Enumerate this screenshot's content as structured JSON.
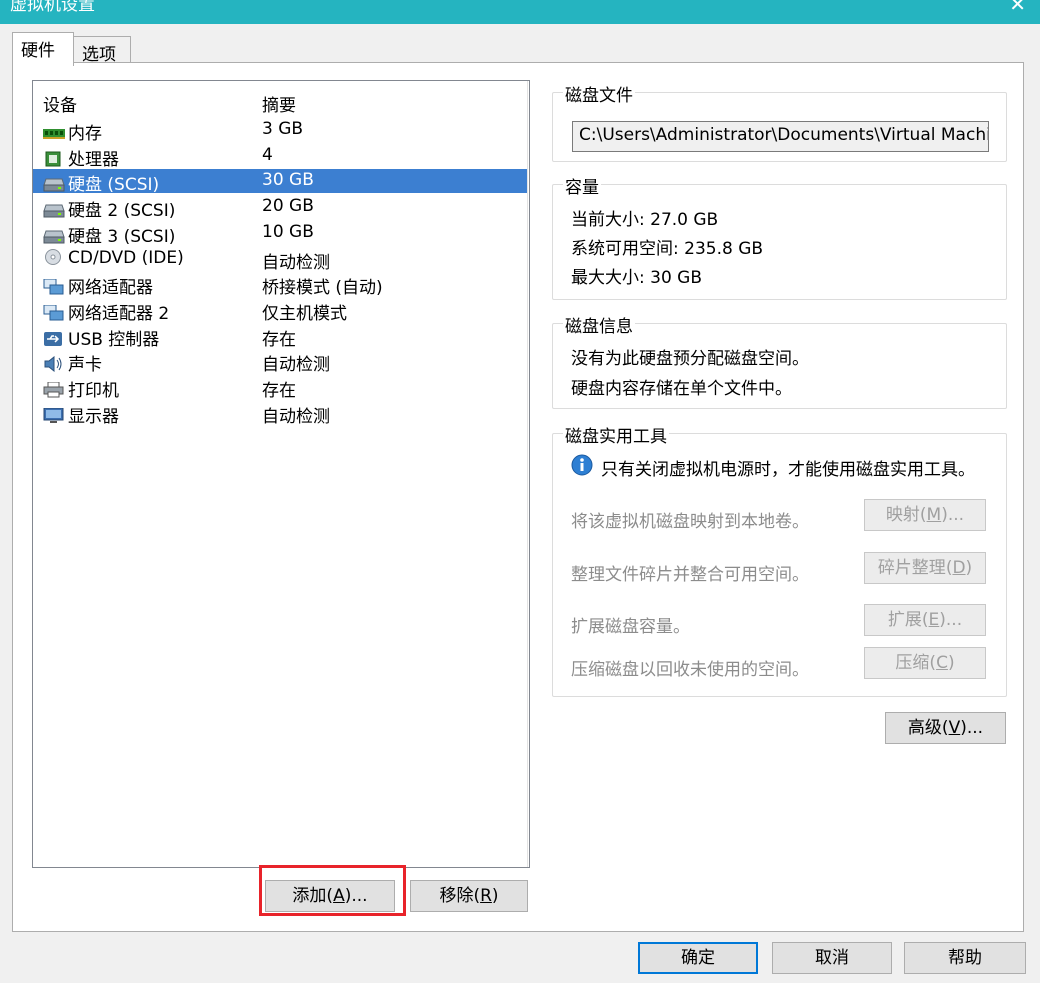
{
  "window": {
    "title": "虚拟机设置",
    "close_glyph": "✕"
  },
  "tabs": [
    {
      "label": "硬件"
    },
    {
      "label": "选项"
    }
  ],
  "device_list": {
    "columns": {
      "device": "设备",
      "summary": "摘要"
    },
    "items": [
      {
        "name": "内存",
        "summary": "3 GB",
        "icon": "memory-icon"
      },
      {
        "name": "处理器",
        "summary": "4",
        "icon": "processor-icon"
      },
      {
        "name": "硬盘 (SCSI)",
        "summary": "30 GB",
        "icon": "harddisk-icon"
      },
      {
        "name": "硬盘 2 (SCSI)",
        "summary": "20 GB",
        "icon": "harddisk-icon"
      },
      {
        "name": "硬盘 3 (SCSI)",
        "summary": "10 GB",
        "icon": "harddisk-icon"
      },
      {
        "name": "CD/DVD (IDE)",
        "summary": "自动检测",
        "icon": "cd-icon"
      },
      {
        "name": "网络适配器",
        "summary": "桥接模式 (自动)",
        "icon": "network-icon"
      },
      {
        "name": "网络适配器 2",
        "summary": "仅主机模式",
        "icon": "network-icon"
      },
      {
        "name": "USB 控制器",
        "summary": "存在",
        "icon": "usb-icon"
      },
      {
        "name": "声卡",
        "summary": "自动检测",
        "icon": "sound-icon"
      },
      {
        "name": "打印机",
        "summary": "存在",
        "icon": "printer-icon"
      },
      {
        "name": "显示器",
        "summary": "自动检测",
        "icon": "display-icon"
      }
    ],
    "selected_index": 2
  },
  "list_buttons": {
    "add": {
      "label": "添加",
      "mnemonic": "A",
      "suffix": "..."
    },
    "remove": {
      "label": "移除",
      "mnemonic": "R",
      "suffix": ""
    }
  },
  "disk_file": {
    "legend": "磁盘文件",
    "path": "C:\\Users\\Administrator\\Documents\\Virtual Machines\\"
  },
  "capacity": {
    "legend": "容量",
    "current_size": "当前大小: 27.0 GB",
    "available_space": "系统可用空间: 235.8 GB",
    "max_size": "最大大小: 30 GB"
  },
  "disk_info": {
    "legend": "磁盘信息",
    "line1": "没有为此硬盘预分配磁盘空间。",
    "line2": "硬盘内容存储在单个文件中。"
  },
  "disk_utilities": {
    "legend": "磁盘实用工具",
    "info": "只有关闭虚拟机电源时，才能使用磁盘实用工具。",
    "rows": [
      {
        "text": "将该虚拟机磁盘映射到本地卷。",
        "button": "映射",
        "mnemonic": "M",
        "suffix": "..."
      },
      {
        "text": "整理文件碎片并整合可用空间。",
        "button": "碎片整理",
        "mnemonic": "D",
        "suffix": ""
      },
      {
        "text": "扩展磁盘容量。",
        "button": "扩展",
        "mnemonic": "E",
        "suffix": "..."
      },
      {
        "text": "压缩磁盘以回收未使用的空间。",
        "button": "压缩",
        "mnemonic": "C",
        "suffix": ""
      }
    ]
  },
  "advanced_button": {
    "label": "高级",
    "mnemonic": "V",
    "suffix": "..."
  },
  "footer": {
    "ok": "确定",
    "cancel": "取消",
    "help": "帮助"
  },
  "colors": {
    "titlebar": "#25b4c0",
    "selection": "#3c7fd1",
    "highlight_box": "#e8232a"
  }
}
